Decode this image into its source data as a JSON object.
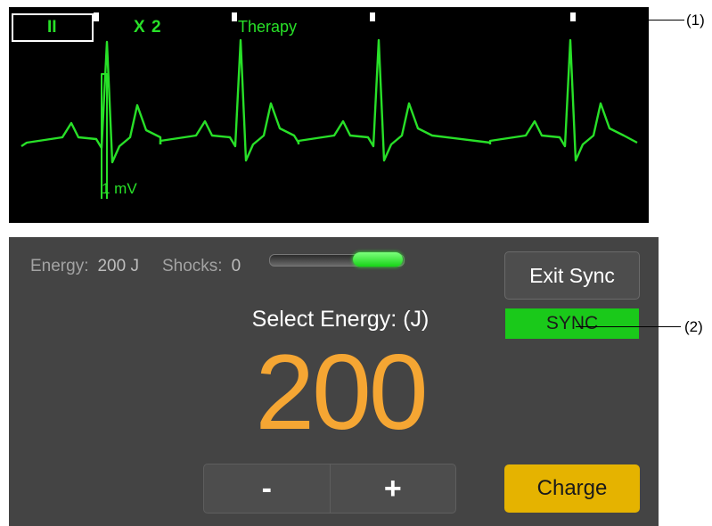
{
  "ecg": {
    "lead": "II",
    "gain": "X 2",
    "mode": "Therapy",
    "calibration": "1 mV",
    "trace_color": "#28e028"
  },
  "defib": {
    "energy_label": "Energy:",
    "energy_value": "200 J",
    "shocks_label": "Shocks:",
    "shocks_value": "0",
    "select_label": "Select Energy: (J)",
    "selected_energy": "200",
    "decrease_label": "-",
    "increase_label": "+",
    "exit_sync_label": "Exit Sync",
    "sync_status": "SYNC",
    "charge_label": "Charge",
    "energy_color": "#f5a633",
    "charge_color": "#e5b300",
    "sync_color": "#1ac91a"
  },
  "callouts": {
    "marker_callout": "(1)",
    "sync_callout": "(2)"
  }
}
